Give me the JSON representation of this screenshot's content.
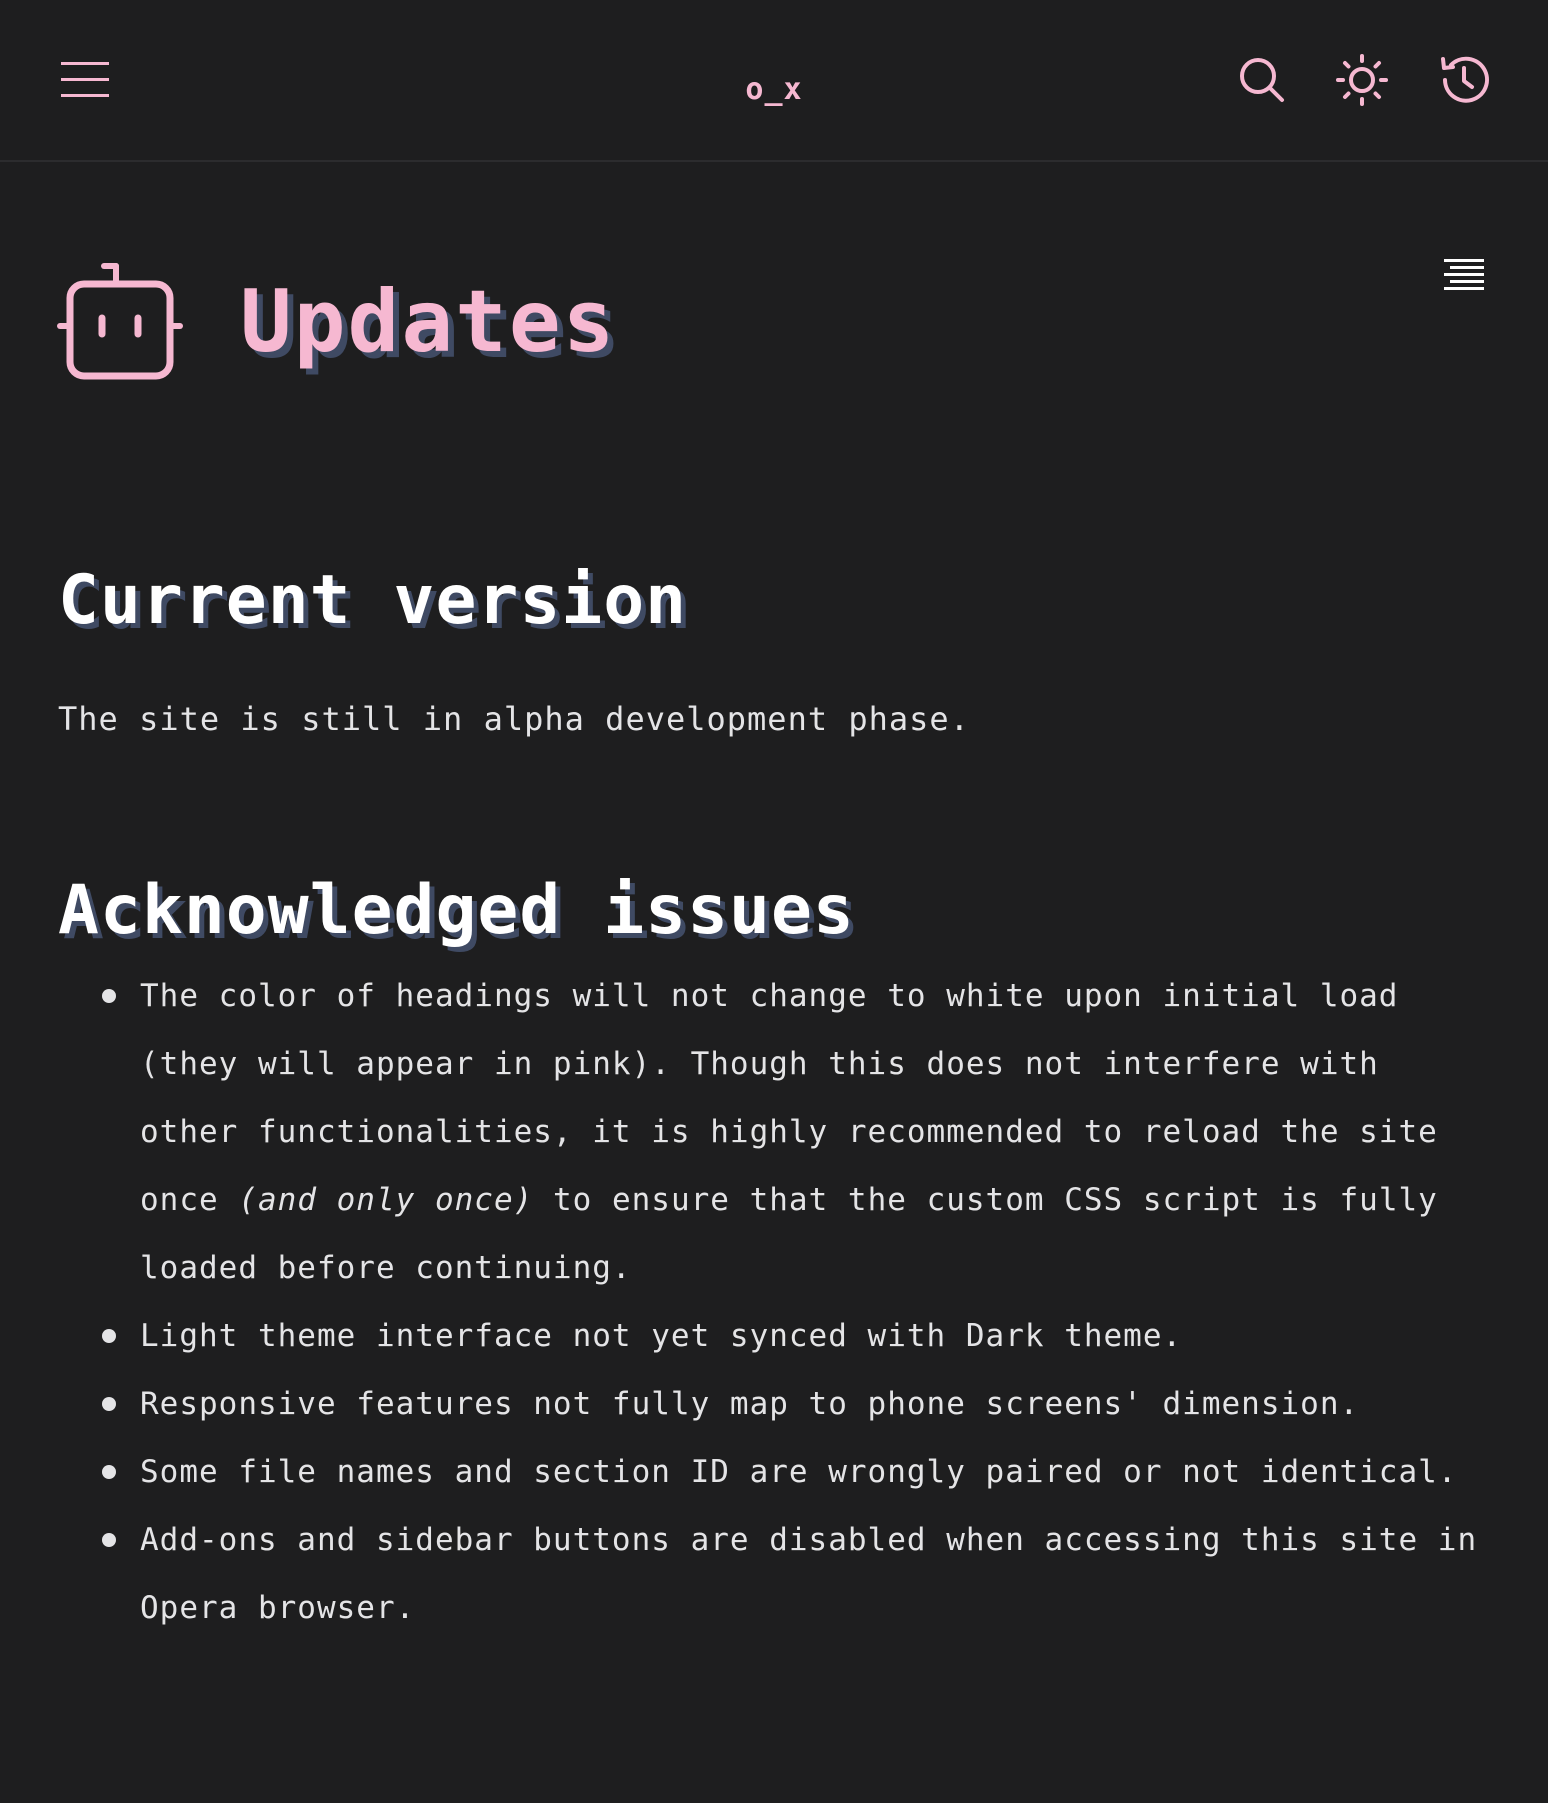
{
  "header": {
    "site_title": "o_x",
    "icons": {
      "menu": "hamburger-menu-icon",
      "search": "search-icon",
      "theme": "sun-icon",
      "history": "history-icon"
    }
  },
  "page": {
    "title": "Updates",
    "title_icon": "robot-icon",
    "toc_icon": "table-of-contents-icon"
  },
  "sections": {
    "current_version": {
      "heading": "Current version",
      "text": "The site is still in alpha development phase."
    },
    "acknowledged_issues": {
      "heading": "Acknowledged issues",
      "items": [
        {
          "before": "The color of headings will not change to white upon initial load (they will appear in pink). Though this does not interfere with other functionalities, it is highly recommended to reload the site once ",
          "emphasis": "(and only once)",
          "after": " to ensure that the custom CSS script is fully loaded before continuing."
        },
        {
          "text": "Light theme interface not yet synced with Dark theme."
        },
        {
          "text": "Responsive features not fully map to phone screens' dimension."
        },
        {
          "text": "Some file names and section ID are wrongly paired or not identical."
        },
        {
          "text": "Add-ons and sidebar buttons are disabled when accessing this site in Opera browser."
        }
      ]
    }
  },
  "colors": {
    "background": "#1e1e1f",
    "accent_pink": "#f6b8d1",
    "heading_shadow": "#3f4a63",
    "text": "#e4e4e6"
  }
}
